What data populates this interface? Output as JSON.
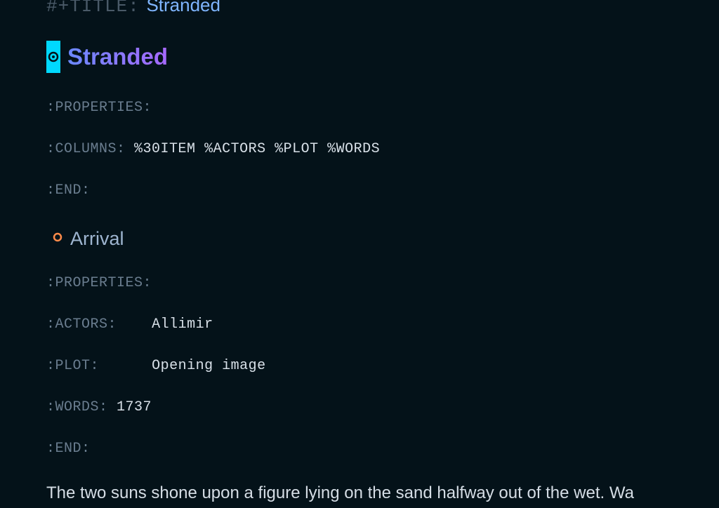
{
  "title_keyword": "#+TITLE:",
  "title_value": "Stranded",
  "h1": "Stranded",
  "drawer1": {
    "properties": ":PROPERTIES:",
    "columns_key": ":COLUMNS:",
    "columns_val": "%30ITEM %ACTORS %PLOT %WORDS",
    "end": ":END:"
  },
  "h2": "Arrival",
  "drawer2": {
    "properties": ":PROPERTIES:",
    "actors_key": ":ACTORS:",
    "actors_val": "Allimir",
    "plot_key": ":PLOT:",
    "plot_val": "Opening image",
    "words_key": ":WORDS:",
    "words_val": "1737",
    "end": ":END:"
  },
  "body": "The two suns shone upon a figure lying on the sand halfway out of the wet. Wa"
}
